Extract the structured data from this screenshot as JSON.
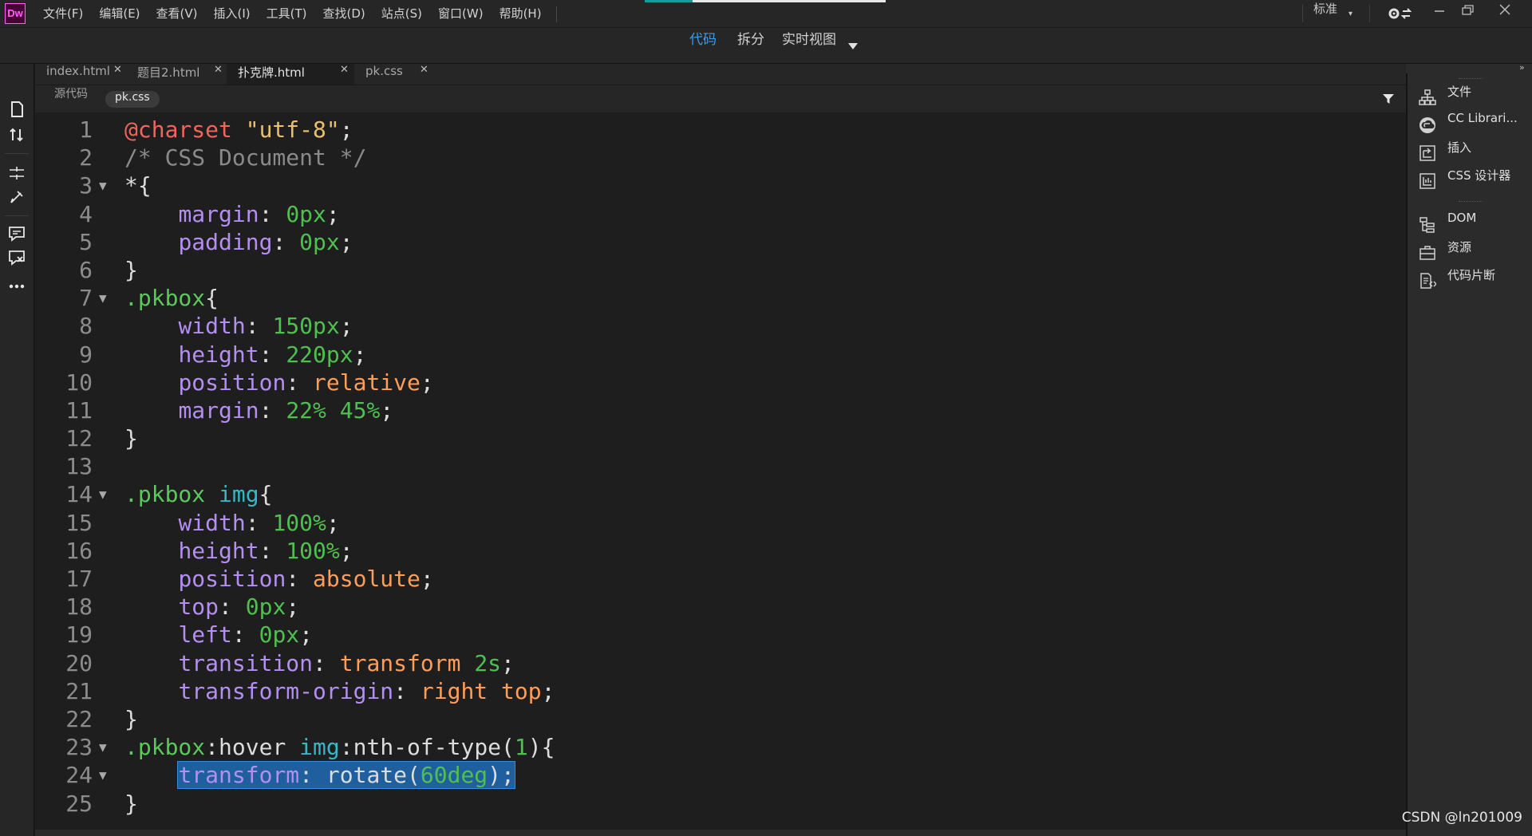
{
  "app": {
    "logo": "Dw"
  },
  "menu": [
    "文件(F)",
    "编辑(E)",
    "查看(V)",
    "插入(I)",
    "工具(T)",
    "查找(D)",
    "站点(S)",
    "窗口(W)",
    "帮助(H)"
  ],
  "workspace": {
    "label": "标准"
  },
  "views": {
    "code": "代码",
    "split": "拆分",
    "live": "实时视图"
  },
  "tabs": [
    {
      "label": "index.html",
      "active": false
    },
    {
      "label": "题目2.html",
      "active": false
    },
    {
      "label": "扑克牌.html",
      "active": true
    },
    {
      "label": "pk.css",
      "active": false
    }
  ],
  "related_files": {
    "source": "源代码",
    "current": "pk.css"
  },
  "panels": {
    "group1": [
      "文件",
      "CC Librari...",
      "插入",
      "CSS 设计器"
    ],
    "group2": [
      "DOM",
      "资源",
      "代码片断"
    ]
  },
  "code": [
    {
      "n": "1",
      "fold": false,
      "tokens": [
        [
          "at",
          "@charset"
        ],
        [
          "plain",
          " "
        ],
        [
          "str",
          "\"utf-8\""
        ],
        [
          "plain",
          ";"
        ]
      ]
    },
    {
      "n": "2",
      "fold": false,
      "tokens": [
        [
          "com",
          "/* CSS Document */"
        ]
      ]
    },
    {
      "n": "3",
      "fold": true,
      "tokens": [
        [
          "sel",
          "*"
        ],
        [
          "plain",
          "{"
        ]
      ]
    },
    {
      "n": "4",
      "fold": false,
      "tokens": [
        [
          "plain",
          "    "
        ],
        [
          "prop",
          "margin"
        ],
        [
          "plain",
          ": "
        ],
        [
          "num",
          "0px"
        ],
        [
          "plain",
          ";"
        ]
      ]
    },
    {
      "n": "5",
      "fold": false,
      "tokens": [
        [
          "plain",
          "    "
        ],
        [
          "prop",
          "padding"
        ],
        [
          "plain",
          ": "
        ],
        [
          "num",
          "0px"
        ],
        [
          "plain",
          ";"
        ]
      ]
    },
    {
      "n": "6",
      "fold": false,
      "tokens": [
        [
          "plain",
          "}"
        ]
      ]
    },
    {
      "n": "7",
      "fold": true,
      "tokens": [
        [
          "class",
          ".pkbox"
        ],
        [
          "plain",
          "{"
        ]
      ]
    },
    {
      "n": "8",
      "fold": false,
      "tokens": [
        [
          "plain",
          "    "
        ],
        [
          "prop",
          "width"
        ],
        [
          "plain",
          ": "
        ],
        [
          "num",
          "150px"
        ],
        [
          "plain",
          ";"
        ]
      ]
    },
    {
      "n": "9",
      "fold": false,
      "tokens": [
        [
          "plain",
          "    "
        ],
        [
          "prop",
          "height"
        ],
        [
          "plain",
          ": "
        ],
        [
          "num",
          "220px"
        ],
        [
          "plain",
          ";"
        ]
      ]
    },
    {
      "n": "10",
      "fold": false,
      "tokens": [
        [
          "plain",
          "    "
        ],
        [
          "prop",
          "position"
        ],
        [
          "plain",
          ": "
        ],
        [
          "kw",
          "relative"
        ],
        [
          "plain",
          ";"
        ]
      ]
    },
    {
      "n": "11",
      "fold": false,
      "tokens": [
        [
          "plain",
          "    "
        ],
        [
          "prop",
          "margin"
        ],
        [
          "plain",
          ": "
        ],
        [
          "num",
          "22% 45%"
        ],
        [
          "plain",
          ";"
        ]
      ]
    },
    {
      "n": "12",
      "fold": false,
      "tokens": [
        [
          "plain",
          "}"
        ]
      ]
    },
    {
      "n": "13",
      "fold": false,
      "tokens": []
    },
    {
      "n": "14",
      "fold": true,
      "tokens": [
        [
          "class",
          ".pkbox"
        ],
        [
          "plain",
          " "
        ],
        [
          "tag",
          "img"
        ],
        [
          "plain",
          "{"
        ]
      ]
    },
    {
      "n": "15",
      "fold": false,
      "tokens": [
        [
          "plain",
          "    "
        ],
        [
          "prop",
          "width"
        ],
        [
          "plain",
          ": "
        ],
        [
          "num",
          "100%"
        ],
        [
          "plain",
          ";"
        ]
      ]
    },
    {
      "n": "16",
      "fold": false,
      "tokens": [
        [
          "plain",
          "    "
        ],
        [
          "prop",
          "height"
        ],
        [
          "plain",
          ": "
        ],
        [
          "num",
          "100%"
        ],
        [
          "plain",
          ";"
        ]
      ]
    },
    {
      "n": "17",
      "fold": false,
      "tokens": [
        [
          "plain",
          "    "
        ],
        [
          "prop",
          "position"
        ],
        [
          "plain",
          ": "
        ],
        [
          "kw",
          "absolute"
        ],
        [
          "plain",
          ";"
        ]
      ]
    },
    {
      "n": "18",
      "fold": false,
      "tokens": [
        [
          "plain",
          "    "
        ],
        [
          "prop",
          "top"
        ],
        [
          "plain",
          ": "
        ],
        [
          "num",
          "0px"
        ],
        [
          "plain",
          ";"
        ]
      ]
    },
    {
      "n": "19",
      "fold": false,
      "tokens": [
        [
          "plain",
          "    "
        ],
        [
          "prop",
          "left"
        ],
        [
          "plain",
          ": "
        ],
        [
          "num",
          "0px"
        ],
        [
          "plain",
          ";"
        ]
      ]
    },
    {
      "n": "20",
      "fold": false,
      "tokens": [
        [
          "plain",
          "    "
        ],
        [
          "prop",
          "transition"
        ],
        [
          "plain",
          ": "
        ],
        [
          "kw",
          "transform"
        ],
        [
          "plain",
          " "
        ],
        [
          "num",
          "2s"
        ],
        [
          "plain",
          ";"
        ]
      ]
    },
    {
      "n": "21",
      "fold": false,
      "tokens": [
        [
          "plain",
          "    "
        ],
        [
          "prop",
          "transform-origin"
        ],
        [
          "plain",
          ": "
        ],
        [
          "kw",
          "right top"
        ],
        [
          "plain",
          ";"
        ]
      ]
    },
    {
      "n": "22",
      "fold": false,
      "tokens": [
        [
          "plain",
          "}"
        ]
      ]
    },
    {
      "n": "23",
      "fold": true,
      "tokens": [
        [
          "class",
          ".pkbox"
        ],
        [
          "plain",
          ":hover "
        ],
        [
          "tag",
          "img"
        ],
        [
          "plain",
          ":nth-of-type("
        ],
        [
          "num",
          "1"
        ],
        [
          "plain",
          "){"
        ]
      ]
    },
    {
      "n": "24",
      "fold": true,
      "selected": true,
      "tokens": [
        [
          "plain",
          "    "
        ],
        [
          "prop",
          "transform"
        ],
        [
          "plain",
          ": rotate("
        ],
        [
          "num",
          "60deg"
        ],
        [
          "plain",
          ");"
        ]
      ]
    },
    {
      "n": "25",
      "fold": false,
      "tokens": [
        [
          "plain",
          "}"
        ]
      ]
    }
  ],
  "watermark": "CSDN @ln201009",
  "colors": {
    "accent": "#3a9cf0",
    "selection": "#1f5f9e",
    "logo_bg": "#470137",
    "logo_fg": "#ff61f6"
  }
}
